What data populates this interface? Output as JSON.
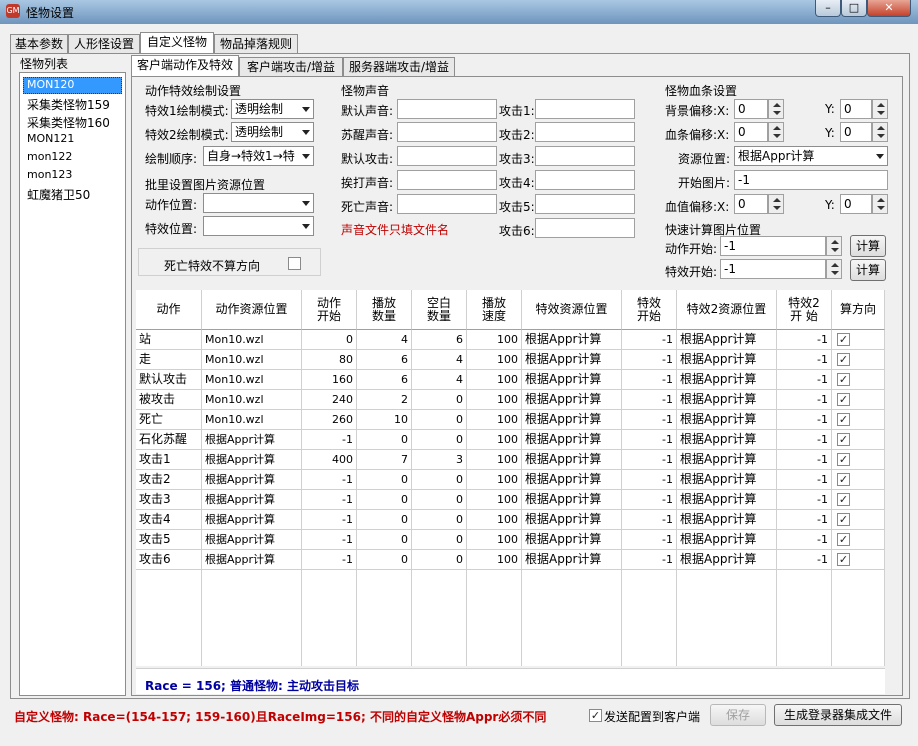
{
  "window": {
    "title": "怪物设置",
    "icon_text": "GM"
  },
  "main_tabs": [
    "基本参数",
    "人形怪设置",
    "自定义怪物",
    "物品掉落规则"
  ],
  "monster_list": {
    "title": "怪物列表",
    "items": [
      "MON120",
      "采集类怪物159",
      "采集类怪物160",
      "MON121",
      "mon122",
      "mon123",
      "虹魔猪卫50"
    ],
    "selected_index": 0
  },
  "sub_tabs": [
    "客户端动作及特效",
    "客户端攻击/增益",
    "服务器端攻击/增益"
  ],
  "effect_group": {
    "title": "动作特效绘制设置",
    "mode1_label": "特效1绘制模式:",
    "mode1_value": "透明绘制",
    "mode2_label": "特效2绘制模式:",
    "mode2_value": "透明绘制",
    "order_label": "绘制顺序:",
    "order_value": "自身→特效1→特"
  },
  "batch_group": {
    "title": "批里设置图片资源位置",
    "action_label": "动作位置:",
    "action_value": "",
    "effect_label": "特效位置:",
    "effect_value": ""
  },
  "death_effect": {
    "label": "死亡特效不算方向",
    "checked": false
  },
  "sound_group": {
    "title": "怪物声音",
    "left_labels": [
      "默认声音:",
      "苏醒声音:",
      "默认攻击:",
      "挨打声音:",
      "死亡声音:"
    ],
    "left_values": [
      "",
      "",
      "",
      "",
      ""
    ],
    "right_labels": [
      "攻击1:",
      "攻击2:",
      "攻击3:",
      "攻击4:",
      "攻击5:",
      "攻击6:"
    ],
    "right_values": [
      "",
      "",
      "",
      "",
      "",
      ""
    ],
    "note": "声音文件只填文件名",
    "note_color": "#c00000"
  },
  "hp_group": {
    "title": "怪物血条设置",
    "bg_label": "背景偏移:X:",
    "bg_x": "0",
    "bg_y_label": "Y:",
    "bg_y": "0",
    "bar_label": "血条偏移:X:",
    "bar_x": "0",
    "bar_y_label": "Y:",
    "bar_y": "0",
    "res_label": "资源位置:",
    "res_value": "根据Appr计算",
    "start_label": "开始图片:",
    "start_value": "-1",
    "val_label": "血值偏移:X:",
    "val_x": "0",
    "val_y_label": "Y:",
    "val_y": "0"
  },
  "quick_group": {
    "title": "快速计算图片位置",
    "action_label": "动作开始:",
    "action_value": "-1",
    "effect_label": "特效开始:",
    "effect_value": "-1",
    "calc_label": "计算"
  },
  "grid": {
    "headers": [
      "动作",
      "动作资源位置",
      "动作\n开始",
      "播放\n数量",
      "空白\n数量",
      "播放\n速度",
      "特效资源位置",
      "特效\n开始",
      "特效2资源位置",
      "特效2\n开 始",
      "算方向"
    ],
    "rows": [
      [
        "站",
        "Mon10.wzl",
        "0",
        "4",
        "6",
        "100",
        "根据Appr计算",
        "-1",
        "根据Appr计算",
        "-1",
        true
      ],
      [
        "走",
        "Mon10.wzl",
        "80",
        "6",
        "4",
        "100",
        "根据Appr计算",
        "-1",
        "根据Appr计算",
        "-1",
        true
      ],
      [
        "默认攻击",
        "Mon10.wzl",
        "160",
        "6",
        "4",
        "100",
        "根据Appr计算",
        "-1",
        "根据Appr计算",
        "-1",
        true
      ],
      [
        "被攻击",
        "Mon10.wzl",
        "240",
        "2",
        "0",
        "100",
        "根据Appr计算",
        "-1",
        "根据Appr计算",
        "-1",
        true
      ],
      [
        "死亡",
        "Mon10.wzl",
        "260",
        "10",
        "0",
        "100",
        "根据Appr计算",
        "-1",
        "根据Appr计算",
        "-1",
        true
      ],
      [
        "石化苏醒",
        "根据Appr计算",
        "-1",
        "0",
        "0",
        "100",
        "根据Appr计算",
        "-1",
        "根据Appr计算",
        "-1",
        true
      ],
      [
        "攻击1",
        "根据Appr计算",
        "400",
        "7",
        "3",
        "100",
        "根据Appr计算",
        "-1",
        "根据Appr计算",
        "-1",
        true
      ],
      [
        "攻击2",
        "根据Appr计算",
        "-1",
        "0",
        "0",
        "100",
        "根据Appr计算",
        "-1",
        "根据Appr计算",
        "-1",
        true
      ],
      [
        "攻击3",
        "根据Appr计算",
        "-1",
        "0",
        "0",
        "100",
        "根据Appr计算",
        "-1",
        "根据Appr计算",
        "-1",
        true
      ],
      [
        "攻击4",
        "根据Appr计算",
        "-1",
        "0",
        "0",
        "100",
        "根据Appr计算",
        "-1",
        "根据Appr计算",
        "-1",
        true
      ],
      [
        "攻击5",
        "根据Appr计算",
        "-1",
        "0",
        "0",
        "100",
        "根据Appr计算",
        "-1",
        "根据Appr计算",
        "-1",
        true
      ],
      [
        "攻击6",
        "根据Appr计算",
        "-1",
        "0",
        "0",
        "100",
        "根据Appr计算",
        "-1",
        "根据Appr计算",
        "-1",
        true
      ]
    ]
  },
  "race_info": {
    "text": "Race = 156; 普通怪物: 主动攻击目标",
    "color": "#0000a0"
  },
  "footer": {
    "warning": "自定义怪物: Race=(154-157; 159-160)且RaceImg=156; 不同的自定义怪物Appr必须不同",
    "warning_color": "#c00000",
    "send_label": "发送配置到客户端",
    "send_checked": true,
    "save_label": "保存",
    "generate_label": "生成登录器集成文件"
  }
}
